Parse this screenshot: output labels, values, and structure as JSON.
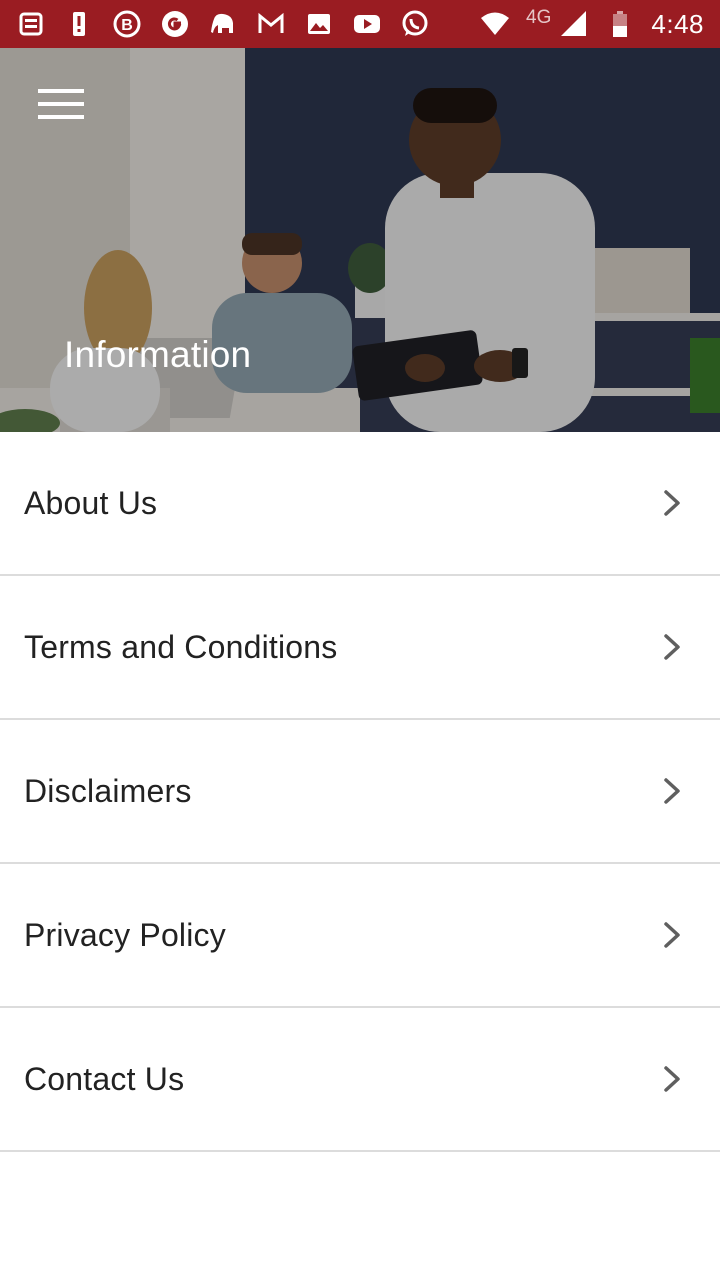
{
  "status_bar": {
    "left_icons": [
      "news-icon",
      "alert-icon",
      "bitcoin-icon",
      "google-icon",
      "elephant-icon",
      "gmail-icon",
      "image-icon",
      "youtube-icon",
      "whatsapp-icon"
    ],
    "network_label": "4G",
    "time": "4:48",
    "background": "#9a1c22"
  },
  "header": {
    "title": "Information",
    "menu_icon": "hamburger-icon"
  },
  "menu_items": [
    {
      "label": "About Us",
      "icon": "chevron-right-icon"
    },
    {
      "label": "Terms and Conditions",
      "icon": "chevron-right-icon"
    },
    {
      "label": "Disclaimers",
      "icon": "chevron-right-icon"
    },
    {
      "label": "Privacy Policy",
      "icon": "chevron-right-icon"
    },
    {
      "label": "Contact Us",
      "icon": "chevron-right-icon"
    }
  ]
}
